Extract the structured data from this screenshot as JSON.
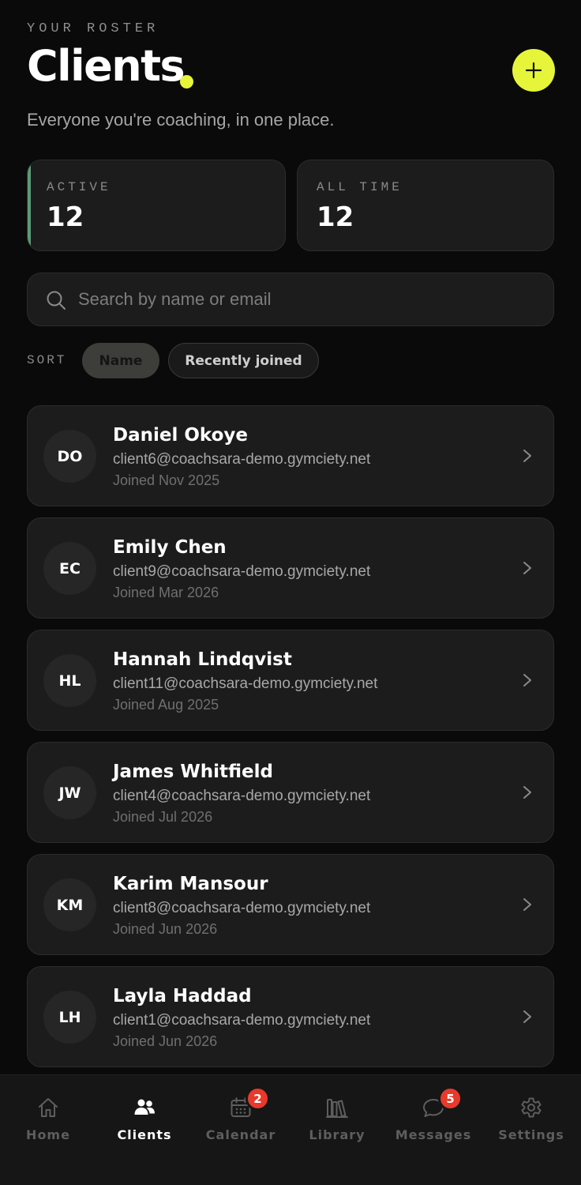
{
  "header": {
    "eyebrow": "YOUR ROSTER",
    "title": "Clients",
    "subtitle": "Everyone you're coaching, in one place.",
    "add_icon": "plus-icon"
  },
  "stats": {
    "active": {
      "label": "ACTIVE",
      "value": "12"
    },
    "all_time": {
      "label": "ALL TIME",
      "value": "12"
    }
  },
  "search": {
    "placeholder": "Search by name or email",
    "value": "",
    "icon": "search-icon"
  },
  "sort": {
    "label": "SORT",
    "options": [
      {
        "label": "Name",
        "selected": true
      },
      {
        "label": "Recently joined",
        "selected": false
      }
    ]
  },
  "clients": [
    {
      "initials": "DO",
      "name": "Daniel Okoye",
      "email": "client6@coachsara-demo.gymciety.net",
      "joined": "Joined Nov 2025"
    },
    {
      "initials": "EC",
      "name": "Emily Chen",
      "email": "client9@coachsara-demo.gymciety.net",
      "joined": "Joined Mar 2026"
    },
    {
      "initials": "HL",
      "name": "Hannah Lindqvist",
      "email": "client11@coachsara-demo.gymciety.net",
      "joined": "Joined Aug 2025"
    },
    {
      "initials": "JW",
      "name": "James Whitfield",
      "email": "client4@coachsara-demo.gymciety.net",
      "joined": "Joined Jul 2026"
    },
    {
      "initials": "KM",
      "name": "Karim Mansour",
      "email": "client8@coachsara-demo.gymciety.net",
      "joined": "Joined Jun 2026"
    },
    {
      "initials": "LH",
      "name": "Layla Haddad",
      "email": "client1@coachsara-demo.gymciety.net",
      "joined": "Joined Jun 2026"
    }
  ],
  "nav": {
    "items": [
      {
        "label": "Home",
        "icon": "home-icon",
        "current": false
      },
      {
        "label": "Clients",
        "icon": "people-icon",
        "current": true
      },
      {
        "label": "Calendar",
        "icon": "calendar-icon",
        "current": false,
        "badge": "2"
      },
      {
        "label": "Library",
        "icon": "library-icon",
        "current": false
      },
      {
        "label": "Messages",
        "icon": "chat-icon",
        "current": false,
        "badge": "5"
      },
      {
        "label": "Settings",
        "icon": "gear-icon",
        "current": false
      }
    ]
  },
  "colors": {
    "accent": "#e6f53a",
    "active_stripe": "#5c9b77",
    "badge": "#e8392b",
    "background": "#0a0a0a",
    "card": "#1c1c1c"
  }
}
